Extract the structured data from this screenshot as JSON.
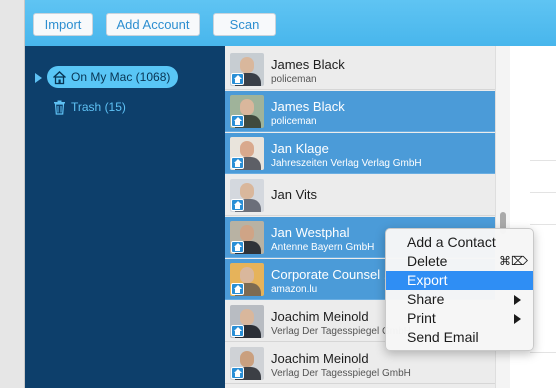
{
  "toolbar": {
    "import_label": "Import",
    "add_account_label": "Add Account",
    "scan_label": "Scan"
  },
  "sidebar": {
    "account_label": "On My Mac (1068)",
    "trash_label": "Trash (15)"
  },
  "contacts": [
    {
      "name": "James Black",
      "subtitle": "policeman",
      "selected": false
    },
    {
      "name": "James Black",
      "subtitle": "policeman",
      "selected": true
    },
    {
      "name": "Jan Klage",
      "subtitle": "Jahreszeiten Verlag Verlag GmbH",
      "selected": true
    },
    {
      "name": "Jan Vits",
      "subtitle": "",
      "selected": false
    },
    {
      "name": "Jan Westphal",
      "subtitle": "Antenne Bayern GmbH",
      "selected": true
    },
    {
      "name": "Corporate Counsel ...",
      "subtitle": "amazon.lu",
      "selected": true
    },
    {
      "name": "Joachim Meinold",
      "subtitle": "Verlag Der Tagesspiegel GmbH",
      "selected": false
    },
    {
      "name": "Joachim Meinold",
      "subtitle": "Verlag Der Tagesspiegel GmbH",
      "selected": false
    }
  ],
  "context_menu": {
    "items": [
      {
        "label": "Add a Contact"
      },
      {
        "label": "Delete",
        "shortcut": "⌘⌦"
      },
      {
        "label": "Export",
        "highlighted": true
      },
      {
        "label": "Share",
        "submenu": true
      },
      {
        "label": "Print",
        "submenu": true
      },
      {
        "label": "Send Email"
      }
    ]
  },
  "colors": {
    "toolbar": "#48b6ec",
    "sidebar": "#0d3f6b",
    "selection": "#4b9bd8",
    "menu_highlight": "#2f8ef4"
  }
}
